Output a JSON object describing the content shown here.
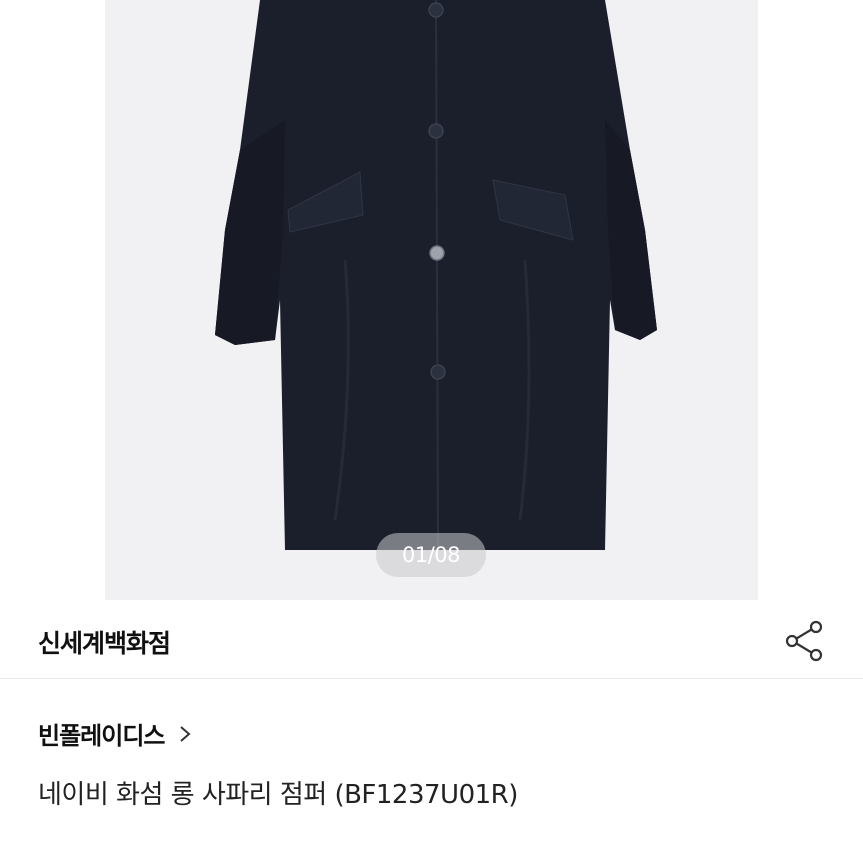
{
  "gallery": {
    "image_alt": "navy long safari jumper product photo",
    "pager": "01/08"
  },
  "store": {
    "name": "신세계백화점"
  },
  "icons": {
    "share": "share-icon",
    "brand_chevron": "chevron-right-icon"
  },
  "product": {
    "brand": "빈폴레이디스",
    "name": "네이비 화섬 롱 사파리 점퍼 (BF1237U01R)"
  },
  "colors": {
    "coat": "#1b1f2b",
    "photo_bg": "#f1f1f3"
  }
}
